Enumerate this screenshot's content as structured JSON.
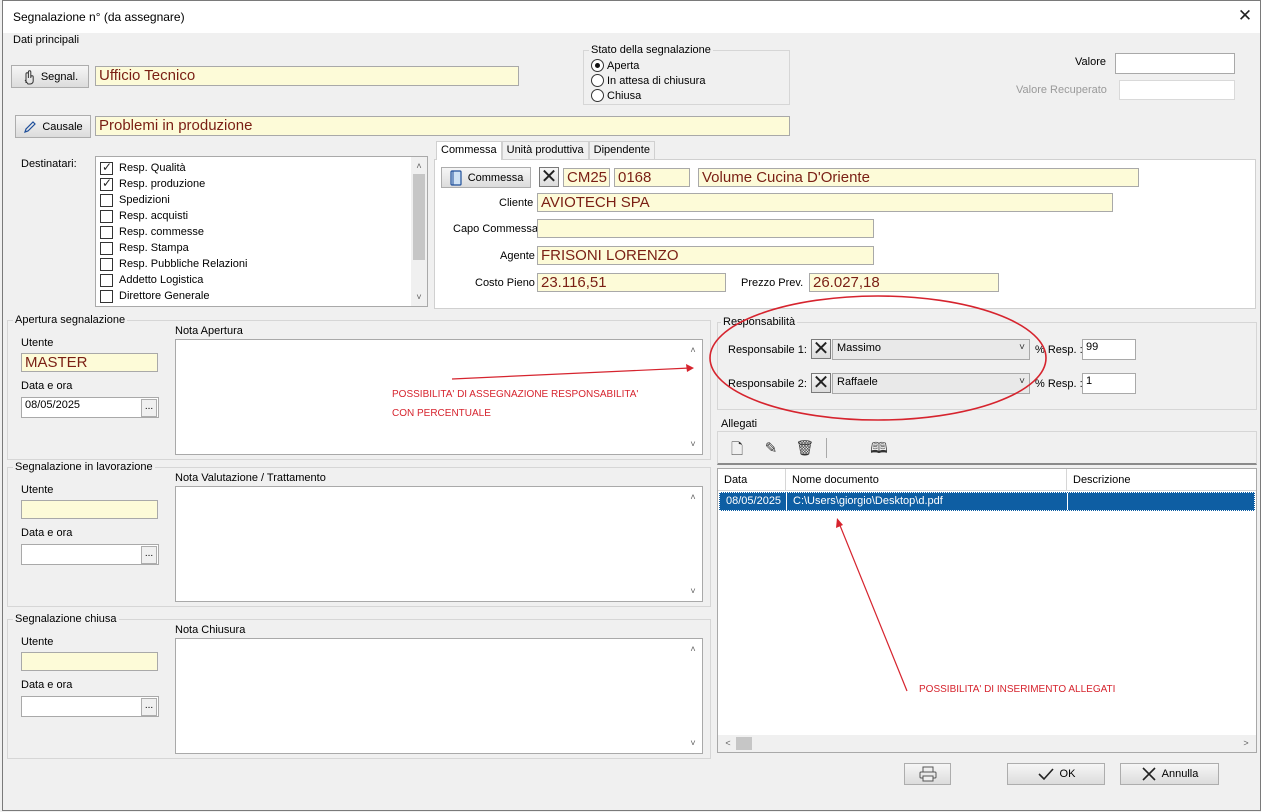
{
  "window": {
    "title": "Segnalazione n° (da assegnare)",
    "close": "✕"
  },
  "principali": {
    "group_label": "Dati principali",
    "segnal_button": "Segnal.",
    "segnal_value": "Ufficio Tecnico",
    "causale_button": "Causale",
    "causale_value": "Problemi in produzione"
  },
  "stato": {
    "label": "Stato della segnalazione",
    "options": [
      "Aperta",
      "In attesa di chiusura",
      "Chiusa"
    ],
    "selected": "Aperta"
  },
  "valore": {
    "label": "Valore",
    "value": "",
    "recuperato_label": "Valore Recuperato",
    "recuperato_value": ""
  },
  "destinatari": {
    "label": "Destinatari:",
    "items": [
      {
        "label": "Resp. Qualità",
        "checked": true
      },
      {
        "label": "Resp. produzione",
        "checked": true
      },
      {
        "label": "Spedizioni",
        "checked": false
      },
      {
        "label": "Resp. acquisti",
        "checked": false
      },
      {
        "label": "Resp. commesse",
        "checked": false
      },
      {
        "label": "Resp. Stampa",
        "checked": false
      },
      {
        "label": "Resp. Pubbliche Relazioni",
        "checked": false
      },
      {
        "label": "Addetto Logistica",
        "checked": false
      },
      {
        "label": "Direttore Generale",
        "checked": false
      }
    ]
  },
  "commessa_tabs": {
    "tabs": [
      "Commessa",
      "Unità produttiva",
      "Dipendente"
    ],
    "active": "Commessa",
    "commessa_button": "Commessa",
    "code1": "CM25",
    "code2": "0168",
    "description": "Volume Cucina D'Oriente",
    "cliente_label": "Cliente",
    "cliente_value": "AVIOTECH SPA",
    "capo_label": "Capo Commessa",
    "capo_value": "",
    "agente_label": "Agente",
    "agente_value": "FRISONI LORENZO",
    "costo_label": "Costo Pieno",
    "costo_value": "23.116,51",
    "prezzo_label": "Prezzo Prev.",
    "prezzo_value": "26.027,18"
  },
  "apertura": {
    "group_label": "Apertura segnalazione",
    "utente_label": "Utente",
    "utente_value": "MASTER",
    "data_label": "Data e ora",
    "data_value": "08/05/2025",
    "nota_label": "Nota Apertura"
  },
  "lavorazione": {
    "group_label": "Segnalazione in lavorazione",
    "utente_label": "Utente",
    "utente_value": "",
    "data_label": "Data e ora",
    "data_value": "",
    "nota_label": "Nota Valutazione / Trattamento"
  },
  "chiusa": {
    "group_label": "Segnalazione chiusa",
    "utente_label": "Utente",
    "utente_value": "",
    "data_label": "Data e ora",
    "data_value": "",
    "nota_label": "Nota Chiusura"
  },
  "annotations": {
    "responsabilita_note_line1": "POSSIBILITA' DI ASSEGNAZIONE RESPONSABILITA'",
    "responsabilita_note_line2": "CON PERCENTUALE",
    "allegati_note": "POSSIBILITA' DI INSERIMENTO ALLEGATI",
    "color": "#d6242e"
  },
  "responsabilita": {
    "group_label": "Responsabilità",
    "rows": [
      {
        "label": "Responsabile 1:",
        "value": "Massimo",
        "pct_label": "% Resp. :",
        "pct": "99"
      },
      {
        "label": "Responsabile 2:",
        "value": "Raffaele",
        "pct_label": "% Resp. :",
        "pct": "1"
      }
    ]
  },
  "allegati": {
    "group_label": "Allegati",
    "columns": [
      "Data",
      "Nome documento",
      "Descrizione"
    ],
    "rows": [
      {
        "data": "08/05/2025",
        "nome": "C:\\Users\\giorgio\\Desktop\\d.pdf",
        "descrizione": ""
      }
    ]
  },
  "footer": {
    "ok_label": "OK",
    "annulla_label": "Annulla"
  }
}
